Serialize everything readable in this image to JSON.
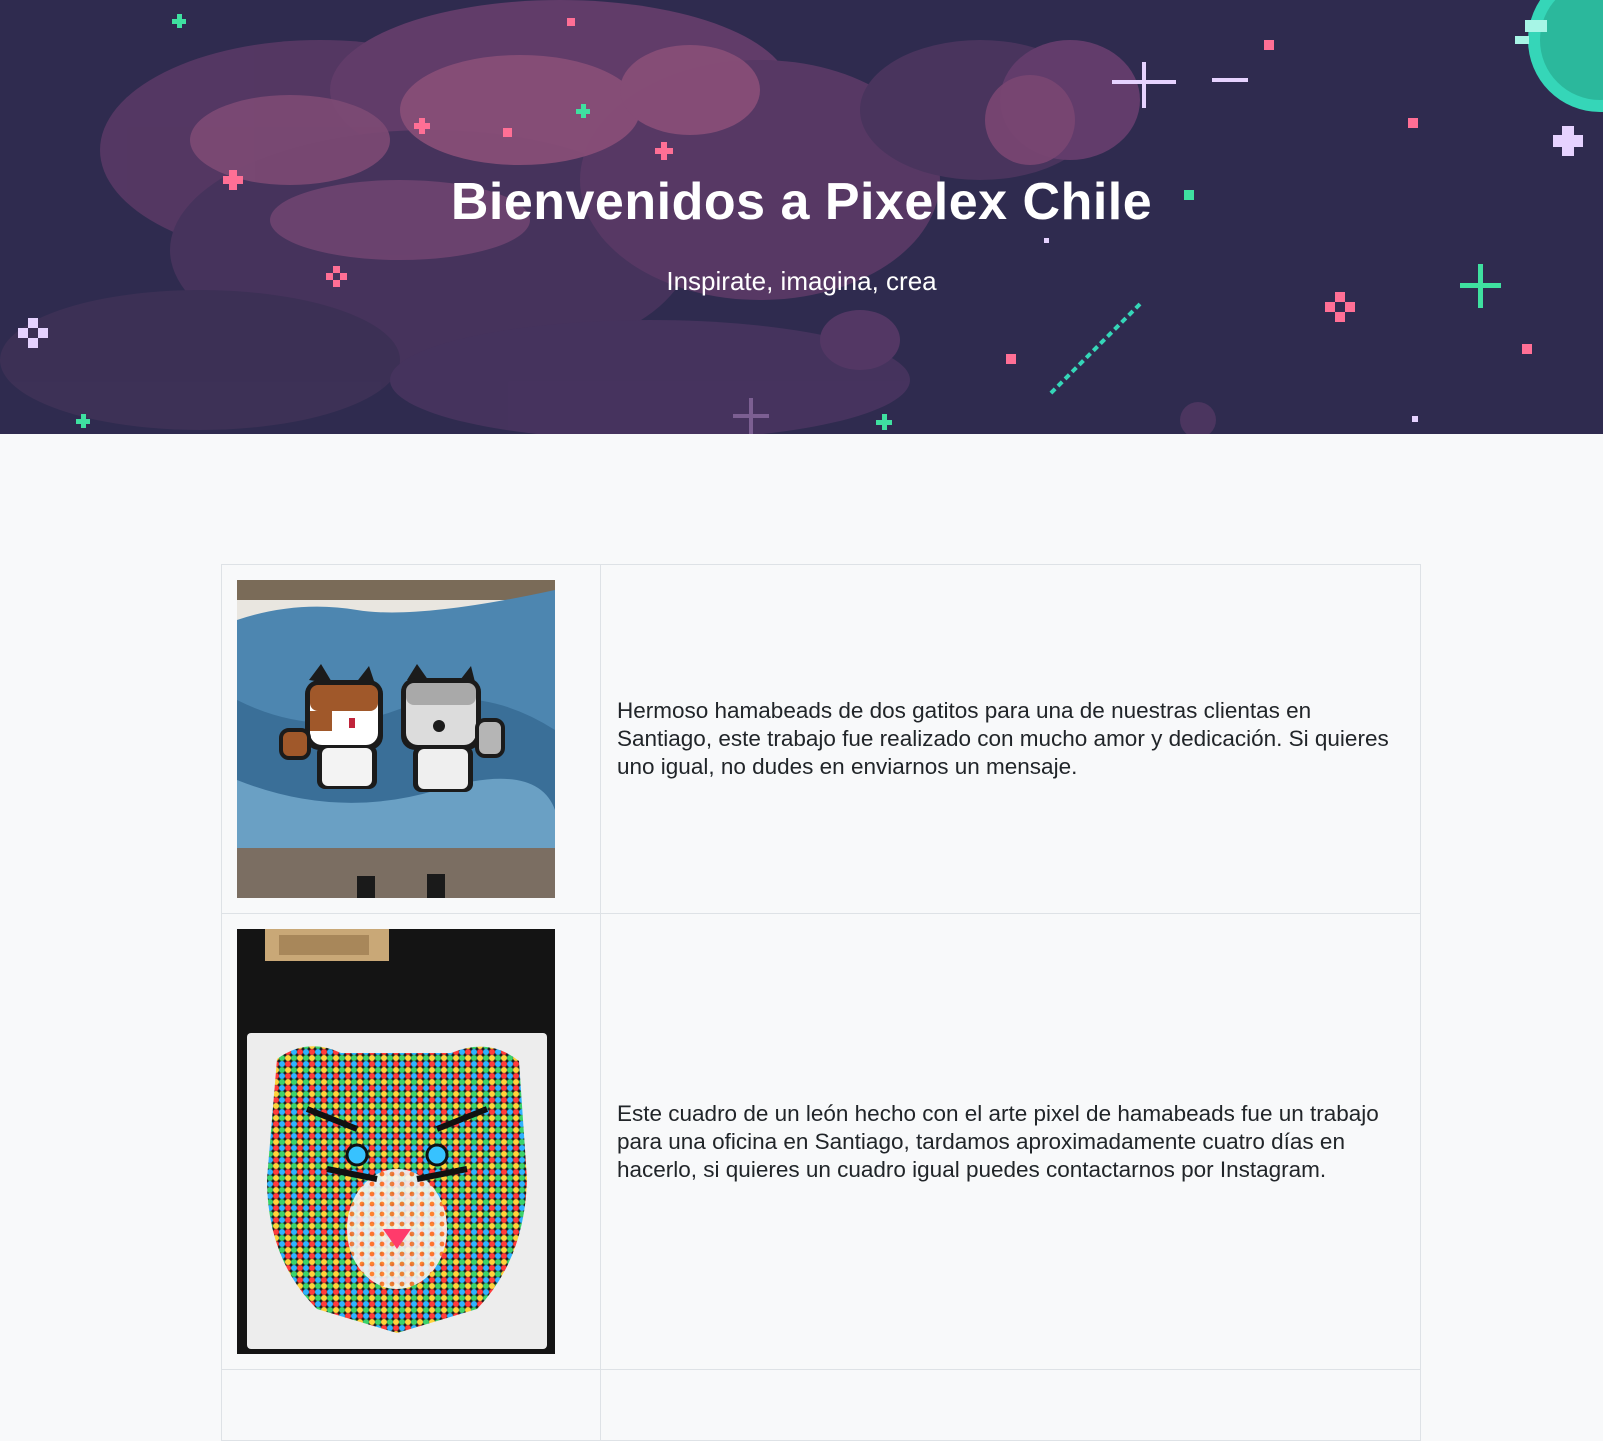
{
  "hero": {
    "title": "Bienvenidos a Pixelex Chile",
    "subtitle": "Inspirate, imagina, crea",
    "background_colors": {
      "sky": "#2f2b4f",
      "nebula": "#6a3f6e",
      "nebula_light": "#8a4f78",
      "star_pink": "#ff4f7a",
      "star_green": "#3fe0a0",
      "planet": "#35d6b8"
    }
  },
  "gallery": {
    "items": [
      {
        "image_label": "hamabeads-dos-gatitos",
        "text": "Hermoso hamabeads de dos gatitos para una de nuestras clientas en Santiago, este trabajo fue realizado con mucho amor y dedicación. Si quieres uno igual, no dudes en enviarnos un mensaje."
      },
      {
        "image_label": "hamabeads-tigre-colores",
        "text": "Este cuadro de un león hecho con el arte pixel de hamabeads fue un trabajo para una oficina en Santiago, tardamos aproximadamente cuatro días en hacerlo, si quieres un cuadro igual puedes contactarnos por Instagram."
      }
    ]
  }
}
